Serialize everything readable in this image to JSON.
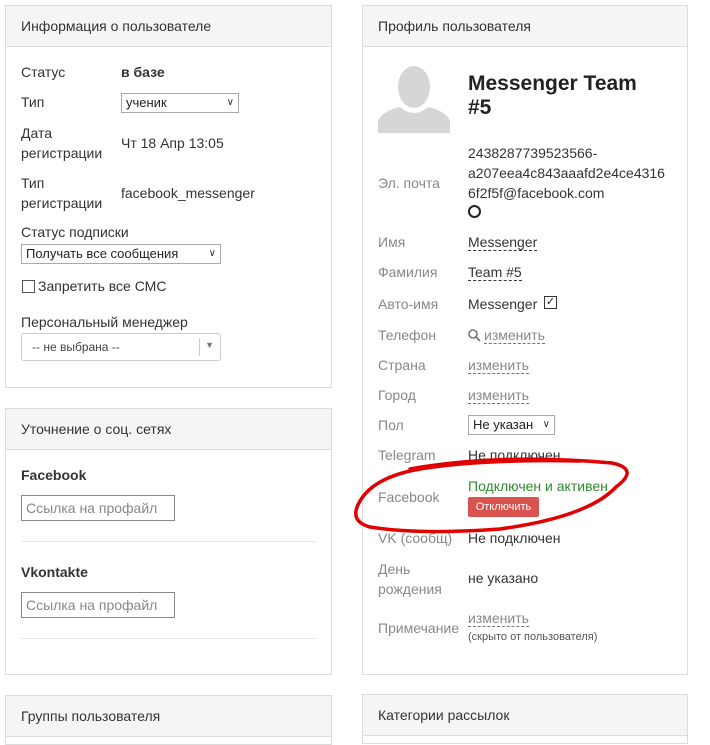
{
  "user_info": {
    "title": "Информация о пользователе",
    "status_label": "Статус",
    "status_value": "в базе",
    "type_label": "Тип",
    "type_value": "ученик",
    "reg_date_label_1": "Дата",
    "reg_date_label_2": "регистрации",
    "reg_date_value": "Чт 18 Апр 13:05",
    "reg_type_label_1": "Тип",
    "reg_type_label_2": "регистрации",
    "reg_type_value": "facebook_messenger",
    "subscription_label": "Статус подписки",
    "subscription_value": "Получать все сообщения",
    "sms_label": "Запретить все СМС",
    "manager_label": "Персональный менеджер",
    "manager_value": "-- не выбрана --"
  },
  "social": {
    "title": "Уточнение о соц. сетях",
    "facebook_label": "Facebook",
    "facebook_placeholder": "Ссылка на профайл",
    "vk_label": "Vkontakte",
    "vk_placeholder": "Ссылка на профайл"
  },
  "groups": {
    "title": "Группы пользователя"
  },
  "profile": {
    "title": "Профиль пользователя",
    "name_line1": "Messenger Team",
    "name_line2": "#5",
    "email_label": "Эл. почта",
    "email_line1": "2438287739523566-",
    "email_line2": "a207eea4c843aaafd2e4ce4316",
    "email_line3": "6f2f5f@facebook.com",
    "first_name_label": "Имя",
    "first_name_value": "Messenger",
    "last_name_label": "Фамилия",
    "last_name_value": "Team #5",
    "auto_name_label": "Авто-имя",
    "auto_name_value": "Messenger",
    "phone_label": "Телефон",
    "phone_value": "изменить",
    "country_label": "Страна",
    "country_value": "изменить",
    "city_label": "Город",
    "city_value": "изменить",
    "gender_label": "Пол",
    "gender_value": "Не указан",
    "telegram_label": "Telegram",
    "telegram_value": "Не подключен",
    "facebook_label": "Facebook",
    "facebook_value": "Подключен и активен",
    "disconnect_button": "Отключить",
    "vk_label": "VK (сообщ)",
    "vk_value": "Не подключен",
    "birthday_label_1": "День",
    "birthday_label_2": "рождения",
    "birthday_value": "не указано",
    "note_label": "Примечание",
    "note_value": "изменить",
    "note_hint": "(скрыто от пользователя)"
  },
  "categories": {
    "title": "Категории рассылок"
  },
  "colors": {
    "connected": "#2e8b2e",
    "disconnect_btn": "#d9534f",
    "annotation": "#e00000"
  }
}
